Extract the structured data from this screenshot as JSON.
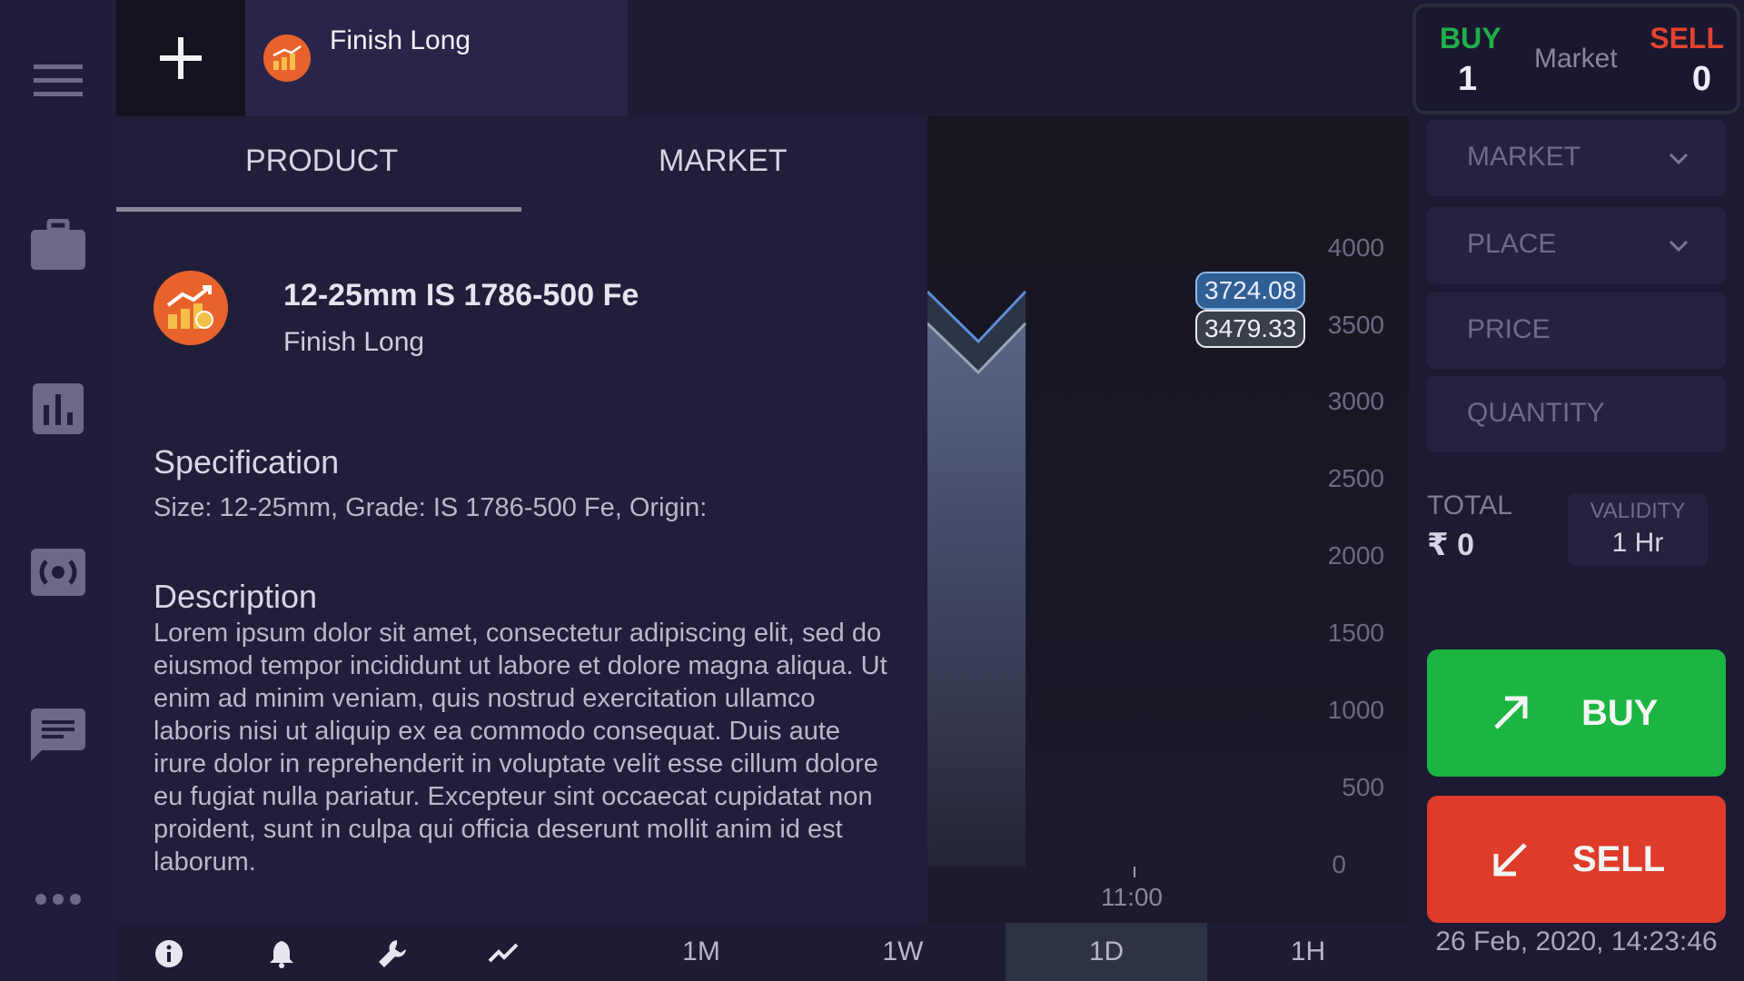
{
  "tab": {
    "title": "Finish Long"
  },
  "panel": {
    "tabs": [
      "PRODUCT",
      "MARKET"
    ],
    "product": {
      "name": "12-25mm IS 1786-500 Fe",
      "subtitle": "Finish Long"
    },
    "specification": {
      "heading": "Specification",
      "text": "Size: 12-25mm, Grade: IS 1786-500 Fe, Origin:"
    },
    "description": {
      "heading": "Description",
      "text": "Lorem ipsum dolor sit amet, consectetur adipiscing elit, sed do eiusmod tempor incididunt ut labore et dolore magna aliqua. Ut enim ad minim veniam, quis nostrud exercitation ullamco laboris nisi ut aliquip ex ea commodo consequat. Duis aute irure dolor in reprehenderit in voluptate velit esse cillum dolore eu fugiat nulla pariatur. Excepteur sint occaecat cupidatat non proident, sunt in culpa qui officia deserunt mollit anim id est laborum."
    }
  },
  "chart": {
    "y_ticks": [
      "4000",
      "3500",
      "3000",
      "2500",
      "2000",
      "1500",
      "1000",
      "500",
      "0"
    ],
    "x_tick": "11:00",
    "price_high": "3724.08",
    "price_low": "3479.33"
  },
  "bottom": {
    "timeframes": [
      "1M",
      "1W",
      "1D",
      "1H"
    ],
    "active_timeframe": "1D"
  },
  "order": {
    "summary": {
      "buy_label": "BUY",
      "buy_count": "1",
      "mode": "Market",
      "sell_label": "SELL",
      "sell_count": "0"
    },
    "fields": [
      "MARKET",
      "PLACE",
      "PRICE",
      "QUANTITY"
    ],
    "total_label": "TOTAL",
    "total_value": "₹ 0",
    "validity_label": "VALIDITY",
    "validity_value": "1 Hr",
    "buy_button": "BUY",
    "sell_button": "SELL",
    "datetime": "26 Feb, 2020, 14:23:46"
  },
  "colors": {
    "buy": "#1bb541",
    "sell": "#de3b2a",
    "accent": "#e8632b"
  },
  "icons": {
    "sidebar": [
      "menu-icon",
      "briefcase-icon",
      "bar-chart-icon",
      "broadcast-icon",
      "chat-icon",
      "more-icon"
    ],
    "bottom": [
      "info-icon",
      "bell-icon",
      "wrench-icon",
      "trend-icon"
    ]
  }
}
